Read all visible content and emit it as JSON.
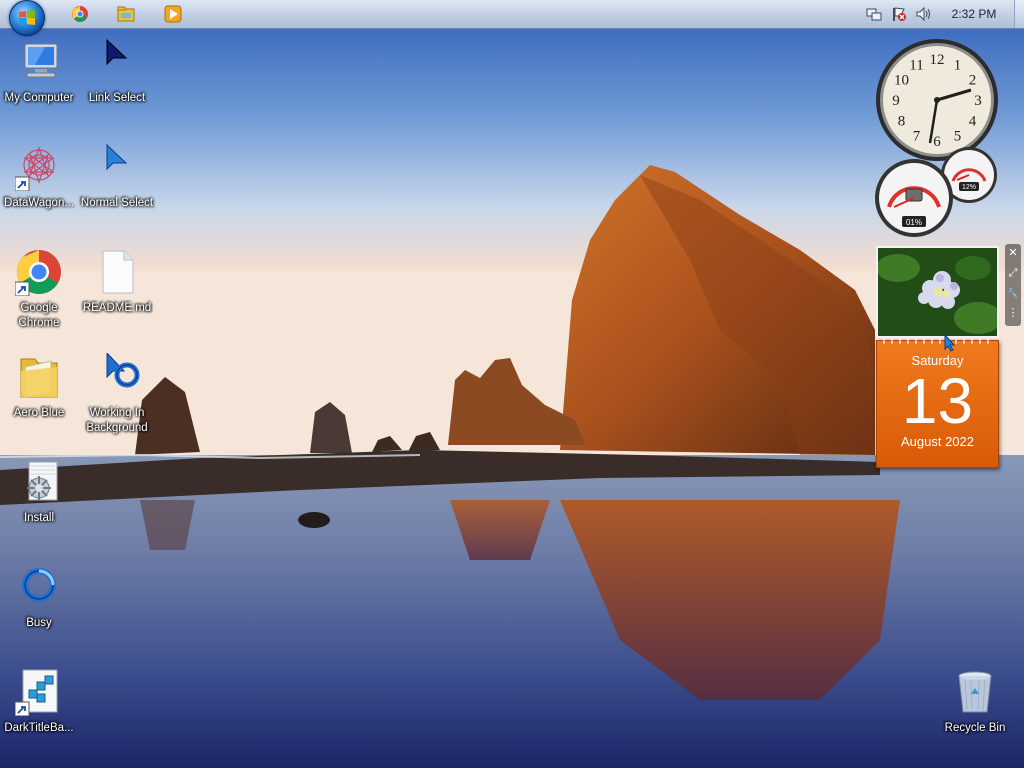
{
  "taskbar": {
    "start": {
      "icon": "windows-flag-icon"
    },
    "pinned": [
      {
        "name": "chrome-icon"
      },
      {
        "name": "file-explorer-icon"
      },
      {
        "name": "media-player-icon"
      }
    ],
    "tray": [
      {
        "name": "network-icon"
      },
      {
        "name": "action-center-flag-icon"
      },
      {
        "name": "volume-icon"
      }
    ],
    "clock": "2:32 PM"
  },
  "desktop": {
    "icons": [
      {
        "label": "My Computer",
        "icon": "computer-icon"
      },
      {
        "label": "Link Select",
        "icon": "cursor-link-select-icon"
      },
      {
        "label": "DataWagon...",
        "icon": "datawagon-icon"
      },
      {
        "label": "Normal Select",
        "icon": "cursor-normal-select-icon"
      },
      {
        "label": "Google Chrome",
        "icon": "chrome-icon"
      },
      {
        "label": "README.md",
        "icon": "document-icon"
      },
      {
        "label": "Aero Blue",
        "icon": "folder-icon"
      },
      {
        "label": "Working In Background",
        "icon": "cursor-working-icon"
      },
      {
        "label": "Install",
        "icon": "installer-icon"
      },
      {
        "label": "Busy",
        "icon": "cursor-busy-icon"
      },
      {
        "label": "DarkTitleBa...",
        "icon": "registry-icon"
      },
      {
        "label": "Recycle Bin",
        "icon": "recycle-bin-icon"
      }
    ]
  },
  "gadgets": {
    "clock": {
      "numbers": [
        "12",
        "1",
        "2",
        "3",
        "4",
        "5",
        "6",
        "7",
        "8",
        "9",
        "10",
        "11"
      ],
      "time": "2:32"
    },
    "cpu_meter": {
      "cpu": "01%",
      "memory": "12%",
      "cpu_level": 0.01,
      "memory_level": 0.12
    },
    "slideshow": {
      "icon": "hydrangea-photo-icon"
    },
    "calendar": {
      "weekday": "Saturday",
      "day": "13",
      "month_year": "August 2022",
      "color": "#e8690f"
    },
    "toolbar": [
      {
        "name": "close-gadget-icon",
        "glyph": "✕"
      },
      {
        "name": "resize-gadget-icon",
        "glyph": "⤢"
      },
      {
        "name": "options-wrench-icon",
        "glyph": "🔧"
      },
      {
        "name": "drag-handle-icon",
        "glyph": "⋮"
      }
    ]
  }
}
